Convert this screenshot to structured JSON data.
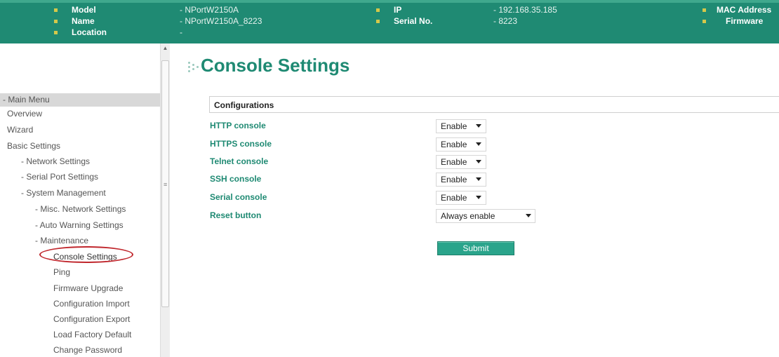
{
  "header": {
    "col1": [
      {
        "label": "Model",
        "value": "- NPortW2150A"
      },
      {
        "label": "Name",
        "value": "- NPortW2150A_8223"
      },
      {
        "label": "Location",
        "value": "-"
      }
    ],
    "col2": [
      {
        "label": "IP",
        "value": "- 192.168.35.185"
      },
      {
        "label": "Serial No.",
        "value": "- 8223"
      }
    ],
    "col3": [
      {
        "label": "MAC Address"
      },
      {
        "label": "Firmware"
      }
    ]
  },
  "sidebar": {
    "menu_head": "- Main Menu",
    "items": [
      {
        "label": "Overview"
      },
      {
        "label": "Wizard"
      },
      {
        "label": "Basic Settings"
      },
      {
        "label": "- Network Settings"
      },
      {
        "label": "- Serial Port Settings"
      },
      {
        "label": "- System Management"
      },
      {
        "label": "- Misc. Network Settings"
      },
      {
        "label": "- Auto Warning Settings"
      },
      {
        "label": "- Maintenance"
      },
      {
        "label": "Console Settings"
      },
      {
        "label": "Ping"
      },
      {
        "label": "Firmware Upgrade"
      },
      {
        "label": "Configuration Import"
      },
      {
        "label": "Configuration Export"
      },
      {
        "label": "Load Factory Default"
      },
      {
        "label": "Change Password"
      }
    ]
  },
  "main": {
    "title": "Console Settings",
    "section": "Configurations",
    "settings": [
      {
        "label": "HTTP console",
        "value": "Enable"
      },
      {
        "label": "HTTPS console",
        "value": "Enable"
      },
      {
        "label": "Telnet console",
        "value": "Enable"
      },
      {
        "label": "SSH console",
        "value": "Enable"
      },
      {
        "label": "Serial console",
        "value": "Enable"
      },
      {
        "label": "Reset button",
        "value": "Always enable"
      }
    ],
    "submit_label": "Submit"
  },
  "colors": {
    "brand_green": "#1f8a73",
    "button_green": "#2aa48b",
    "highlight_red": "#c0272d"
  }
}
